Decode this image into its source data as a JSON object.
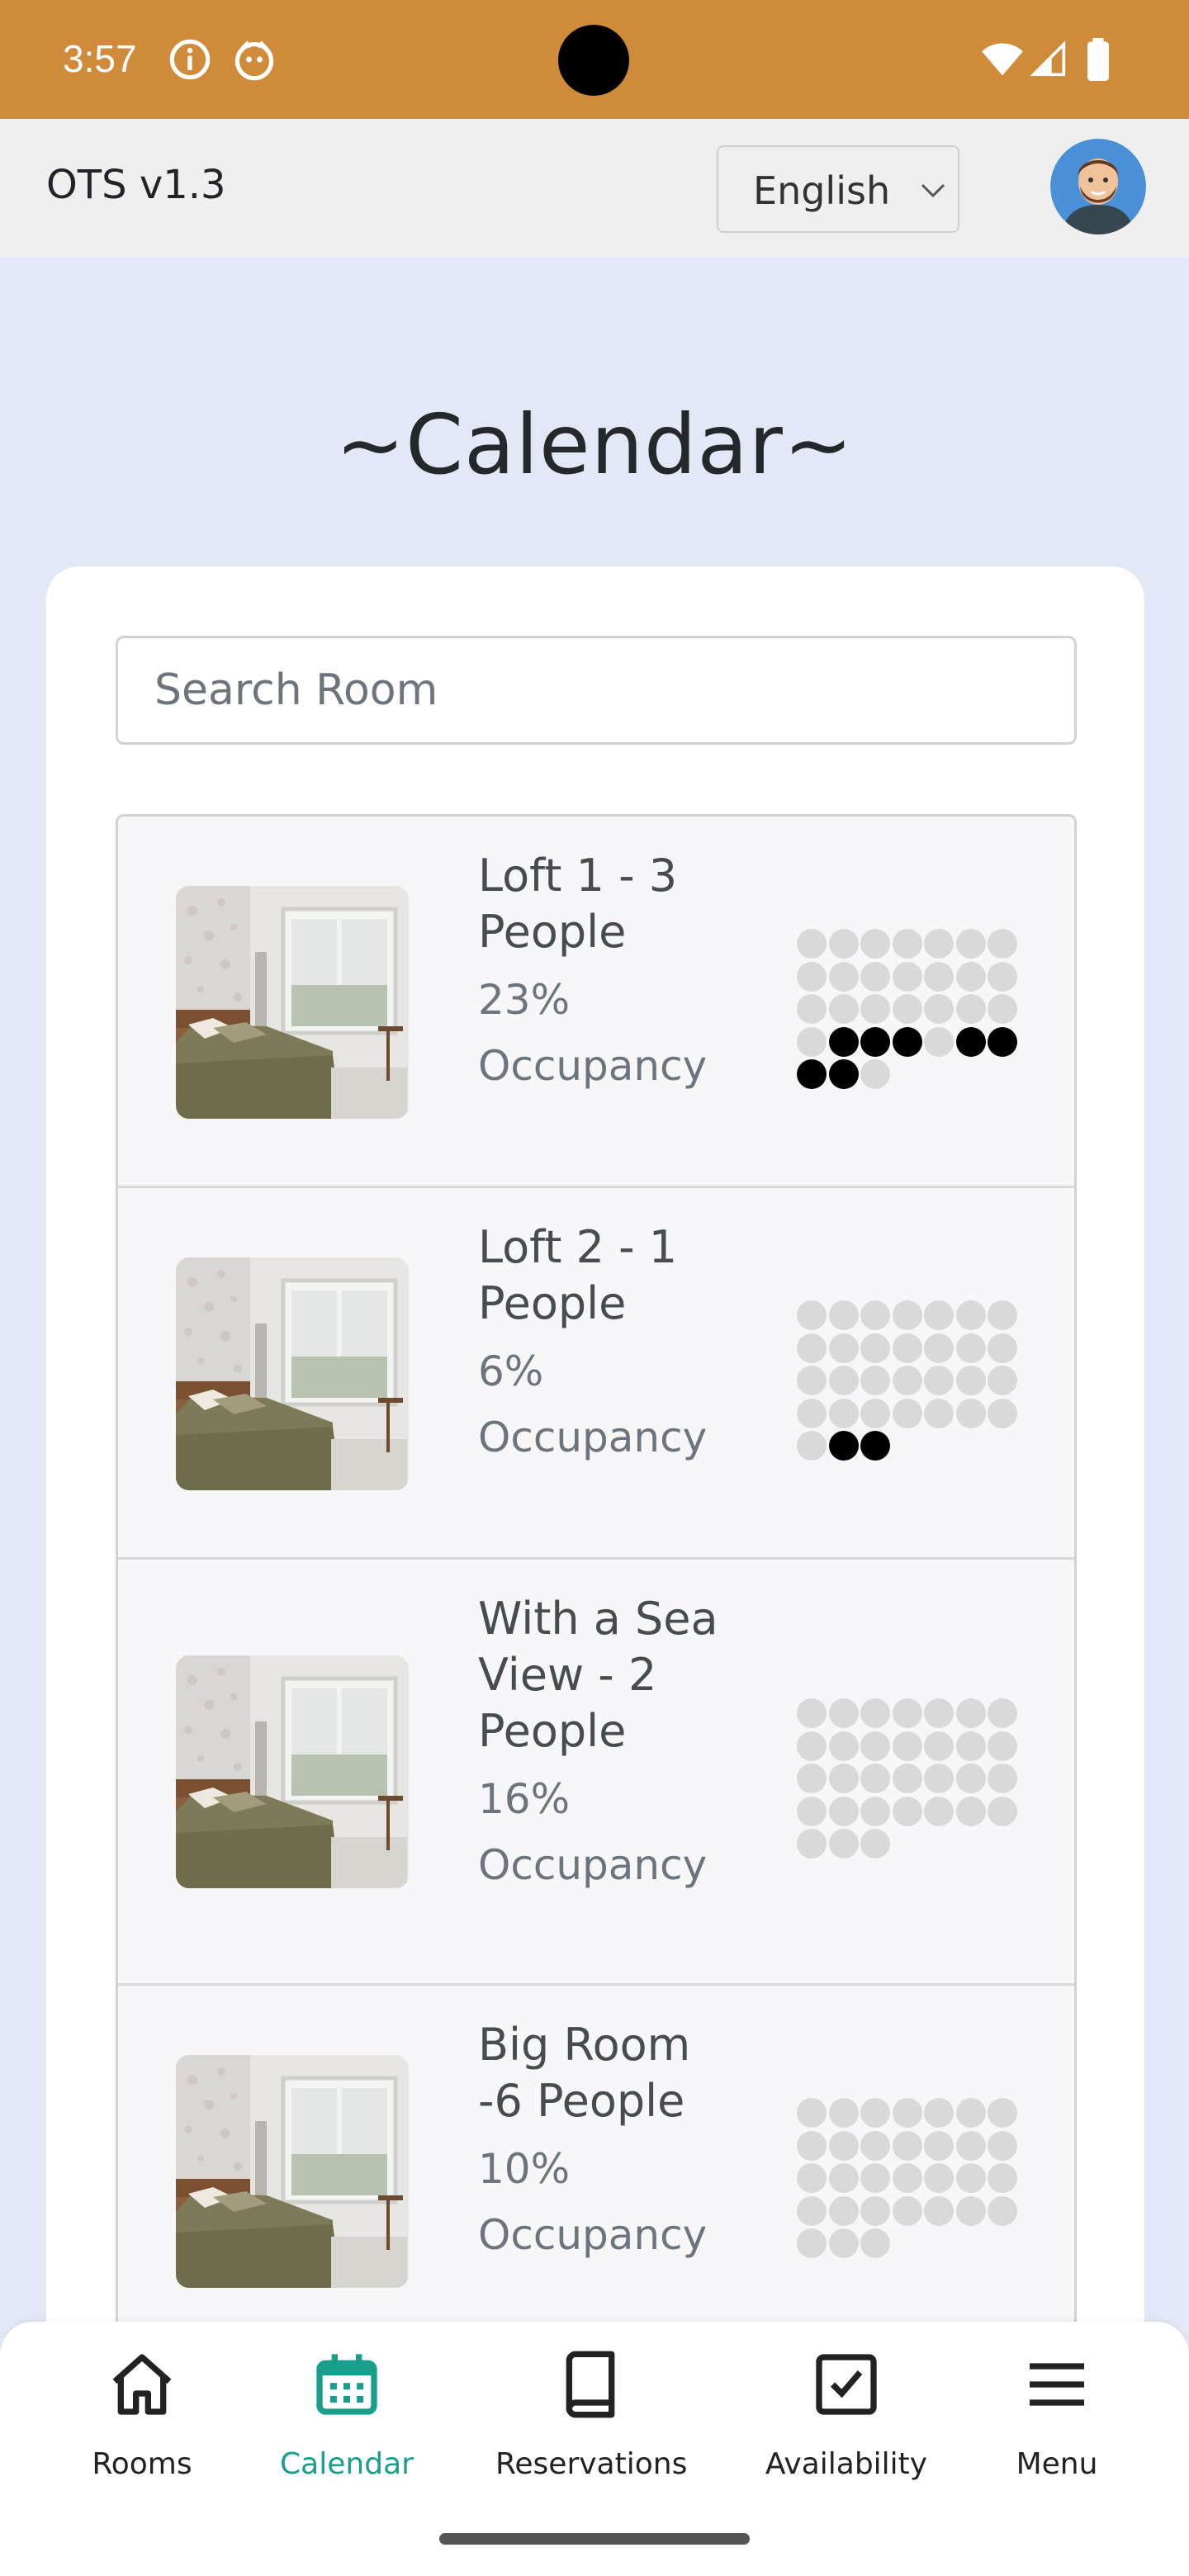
{
  "status_bar": {
    "time": "3:57",
    "color": "#cf8a3a"
  },
  "header": {
    "app_title": "OTS v1.3",
    "language": "English"
  },
  "page": {
    "title": "~Calendar~"
  },
  "search": {
    "placeholder": "Search Room"
  },
  "rooms": [
    {
      "name": "Loft 1 - 3 People",
      "name_lines": [
        "Loft 1 - 3",
        "People"
      ],
      "occupancy": "23%",
      "occupancy_label": "Occupancy",
      "dots_total": 31,
      "dots_on": [
        22,
        23,
        24,
        26,
        27,
        28,
        29
      ]
    },
    {
      "name": "Loft 2 - 1 People",
      "name_lines": [
        "Loft 2 - 1",
        "People"
      ],
      "occupancy": "6%",
      "occupancy_label": "Occupancy",
      "dots_total": 31,
      "dots_on": [
        29,
        30
      ]
    },
    {
      "name": "With a Sea View - 2 People",
      "name_lines": [
        "With a Sea",
        "View - 2",
        "People"
      ],
      "occupancy": "16%",
      "occupancy_label": "Occupancy",
      "dots_total": 31,
      "dots_on": []
    },
    {
      "name": "Big Room -6 People",
      "name_lines": [
        "Big Room",
        "-6 People"
      ],
      "occupancy": "10%",
      "occupancy_label": "Occupancy",
      "dots_total": 31,
      "dots_on": []
    }
  ],
  "nav": {
    "active_color": "#1a9e8c",
    "items": [
      {
        "label": "Rooms",
        "icon": "home-icon"
      },
      {
        "label": "Calendar",
        "icon": "calendar-icon",
        "active": true
      },
      {
        "label": "Reservations",
        "icon": "book-icon"
      },
      {
        "label": "Availability",
        "icon": "checkbox-icon"
      },
      {
        "label": "Menu",
        "icon": "menu-icon"
      }
    ]
  }
}
